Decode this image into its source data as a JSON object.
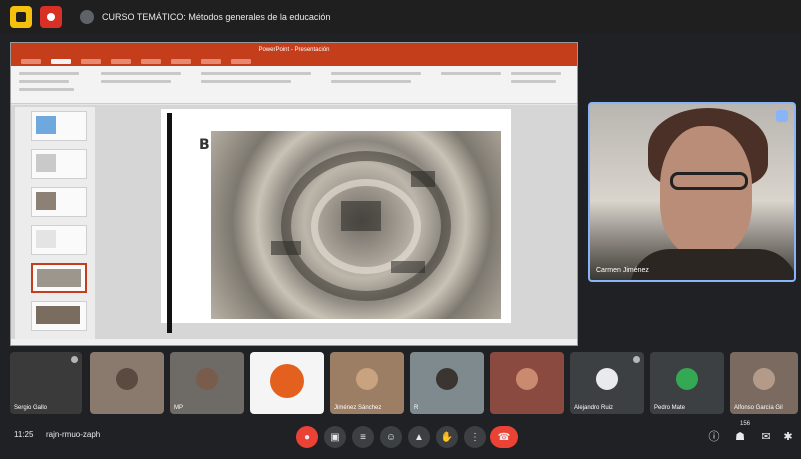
{
  "topbar": {
    "title": "CURSO TEMÁTICO: Métodos generales de la educación"
  },
  "presentation": {
    "window_title": "PowerPoint - Presentación",
    "slide_letter": "B"
  },
  "speaker": {
    "name": "Carmen Jiménez"
  },
  "participants": [
    {
      "name": "Sergio Gallo"
    },
    {
      "name": ""
    },
    {
      "name": "MP"
    },
    {
      "name": ""
    },
    {
      "name": "Jiménez Sánchez"
    },
    {
      "name": "R"
    },
    {
      "name": ""
    },
    {
      "name": "Alejandro Ruiz"
    },
    {
      "name": "Pedro Mate"
    },
    {
      "name": "Alfonso García Gil"
    }
  ],
  "bottombar": {
    "time": "11:25",
    "meeting_code": "rajn-rmuo-zaph",
    "participants_badge": "156"
  },
  "colors": {
    "ppt_accent": "#c43e1c",
    "meet_bg": "#202124",
    "end_call": "#ea4335",
    "speaker_border": "#8ab4f8"
  }
}
